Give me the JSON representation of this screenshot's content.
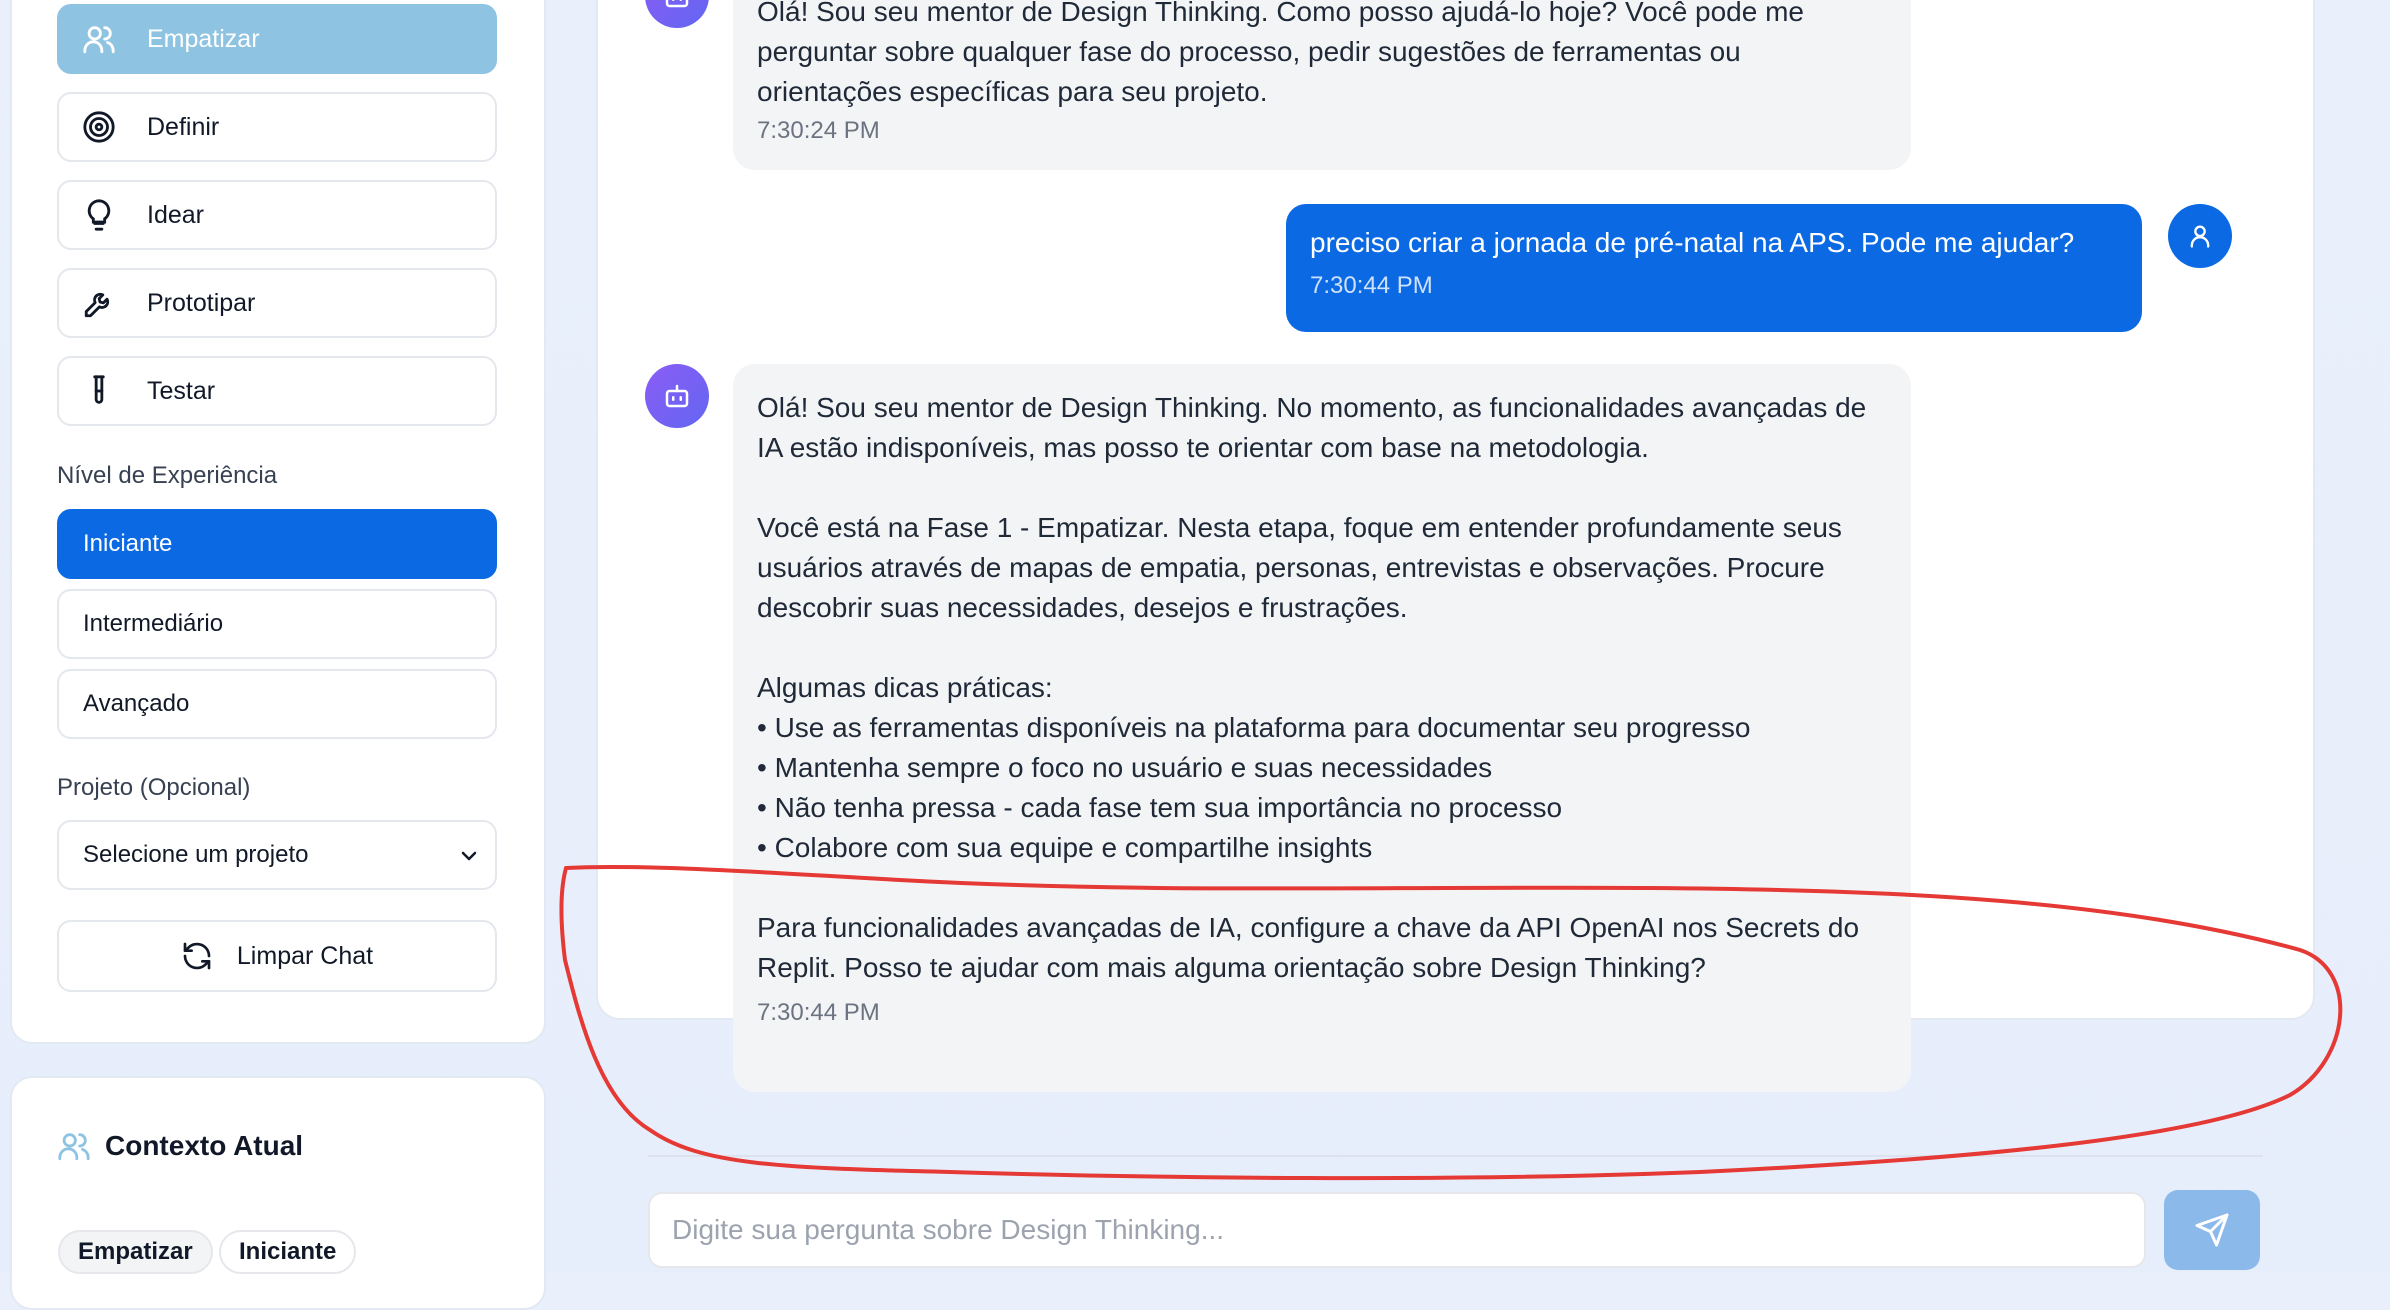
{
  "sidebar": {
    "phases": [
      {
        "label": "Empatizar",
        "icon": "users-icon",
        "active": true
      },
      {
        "label": "Definir",
        "icon": "target-icon",
        "active": false
      },
      {
        "label": "Idear",
        "icon": "lightbulb-icon",
        "active": false
      },
      {
        "label": "Prototipar",
        "icon": "wrench-icon",
        "active": false
      },
      {
        "label": "Testar",
        "icon": "test-tube-icon",
        "active": false
      }
    ],
    "experience_label": "Nível de Experiência",
    "levels": [
      {
        "label": "Iniciante",
        "active": true
      },
      {
        "label": "Intermediário",
        "active": false
      },
      {
        "label": "Avançado",
        "active": false
      }
    ],
    "project_label": "Projeto (Opcional)",
    "project_select": "Selecione um projeto",
    "clear_button": "Limpar Chat"
  },
  "context": {
    "title": "Contexto Atual",
    "tags": [
      "Empatizar",
      "Iniciante"
    ]
  },
  "chat": {
    "messages": [
      {
        "role": "bot",
        "text": "Olá! Sou seu mentor de Design Thinking. Como posso ajudá-lo hoje? Você pode me perguntar sobre qualquer fase do processo, pedir sugestões de ferramentas ou orientações específicas para seu projeto.",
        "time": "7:30:24 PM"
      },
      {
        "role": "user",
        "text": "preciso criar a jornada de pré-natal na APS. Pode me ajudar?",
        "time": "7:30:44 PM"
      },
      {
        "role": "bot",
        "text": "Olá! Sou seu mentor de Design Thinking. No momento, as funcionalidades avançadas de IA estão indisponíveis, mas posso te orientar com base na metodologia.\n\nVocê está na Fase 1 - Empatizar. Nesta etapa, foque em entender profundamente seus usuários através de mapas de empatia, personas, entrevistas e observações. Procure descobrir suas necessidades, desejos e frustrações.\n\nAlgumas dicas práticas:\n• Use as ferramentas disponíveis na plataforma para documentar seu progresso\n• Mantenha sempre o foco no usuário e suas necessidades\n• Não tenha pressa - cada fase tem sua importância no processo\n• Colabore com sua equipe e compartilhe insights\n\nPara funcionalidades avançadas de IA, configure a chave da API OpenAI nos Secrets do Replit. Posso te ajudar com mais alguma orientação sobre Design Thinking?",
        "time": "7:30:44 PM"
      }
    ],
    "input_placeholder": "Digite sua pergunta sobre Design Thinking...",
    "send_icon": "send-icon"
  },
  "colors": {
    "primary": "#0b6ae3",
    "active_phase": "#8fc3e2",
    "bot_bubble": "#f3f4f6",
    "annotation": "#e53935"
  }
}
